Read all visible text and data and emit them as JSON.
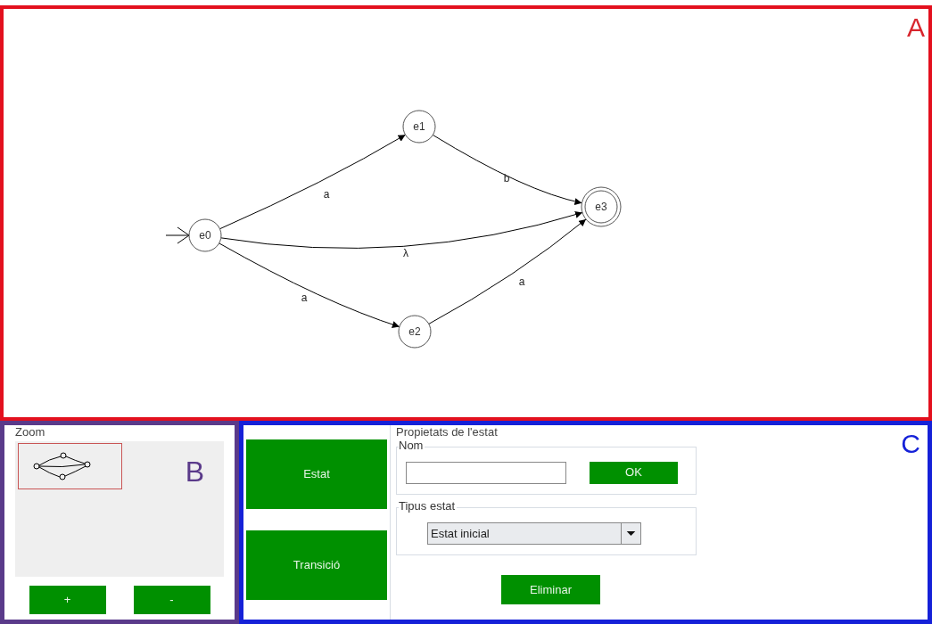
{
  "canvas_panel": {
    "marker": "A",
    "nodes": [
      {
        "label": "e0",
        "initial": true,
        "accepting": false
      },
      {
        "label": "e1",
        "initial": false,
        "accepting": false
      },
      {
        "label": "e2",
        "initial": false,
        "accepting": false
      },
      {
        "label": "e3",
        "initial": false,
        "accepting": true
      }
    ],
    "edges": [
      {
        "label": "a"
      },
      {
        "label": "b"
      },
      {
        "label": "λ"
      },
      {
        "label": "a"
      },
      {
        "label": "a"
      }
    ]
  },
  "zoom_panel": {
    "title": "Zoom",
    "marker": "B",
    "buttons": [
      "+",
      "-"
    ]
  },
  "tools_panel": {
    "marker": "C",
    "tool_buttons": [
      "Estat",
      "Transició"
    ],
    "properties": {
      "title": "Propietats de l'estat",
      "name_group": {
        "legend": "Nom",
        "ok_button": "OK"
      },
      "type_group": {
        "legend": "Tipus estat",
        "value": "Estat inicial"
      },
      "delete_button": "Eliminar"
    }
  }
}
